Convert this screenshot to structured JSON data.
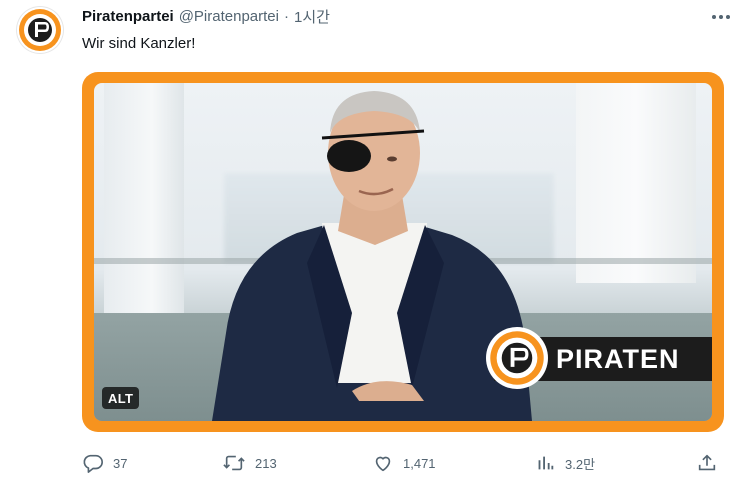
{
  "tweet": {
    "author_name": "Piratenpartei",
    "handle": "@Piratenpartei",
    "separator": "·",
    "time": "1시간",
    "text": "Wir sind Kanzler!",
    "media": {
      "alt_badge": "ALT",
      "brand_text": "PIRATEN",
      "frame_color": "#f7931e"
    },
    "actions": {
      "replies": "37",
      "reposts": "213",
      "likes": "1,471",
      "views": "3.2만"
    },
    "icons": {
      "more": "more-icon",
      "reply": "reply-icon",
      "repost": "repost-icon",
      "like": "like-icon",
      "views": "views-icon",
      "share": "share-icon"
    }
  }
}
